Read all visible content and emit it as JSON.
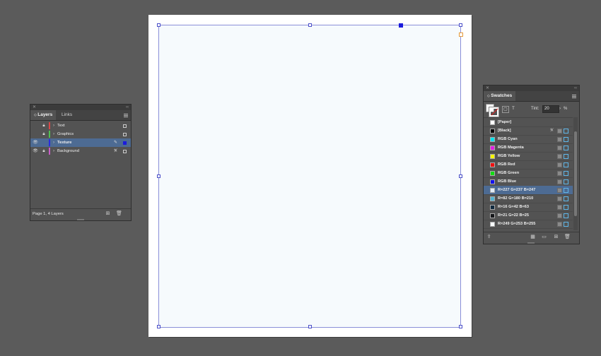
{
  "layers_panel": {
    "tabs": [
      {
        "label": "Layers"
      },
      {
        "label": "Links"
      }
    ],
    "layers": [
      {
        "name": "Text",
        "color": "#d94848",
        "visible": false,
        "locked": true,
        "selected": false
      },
      {
        "name": "Graphics",
        "color": "#52c152",
        "visible": false,
        "locked": true,
        "selected": false
      },
      {
        "name": "Texture",
        "color": "#2a2ae0",
        "visible": true,
        "locked": false,
        "selected": true
      },
      {
        "name": "Background",
        "color": "#c85dc8",
        "visible": true,
        "locked": true,
        "selected": false
      }
    ],
    "footer": {
      "status": "Page 1, 4 Layers"
    }
  },
  "swatches_panel": {
    "tab": {
      "label": "Swatches"
    },
    "tint": {
      "label": "Tint:",
      "value": "20",
      "unit": "%"
    },
    "swatches": [
      {
        "name": "[Paper]",
        "color": "#ffffff"
      },
      {
        "name": "[Black]",
        "color": "#000000"
      },
      {
        "name": "RGB Cyan",
        "color": "#00e5ee"
      },
      {
        "name": "RGB Magenta",
        "color": "#e020e0"
      },
      {
        "name": "RGB Yellow",
        "color": "#f5f500"
      },
      {
        "name": "RGB Red",
        "color": "#ee1111"
      },
      {
        "name": "RGB Green",
        "color": "#11dd11"
      },
      {
        "name": "RGB Blue",
        "color": "#1111ee"
      },
      {
        "name": "R=227 G=237 B=247",
        "color": "#e3edf7"
      },
      {
        "name": "R=82 G=180 B=210",
        "color": "#52b4d2"
      },
      {
        "name": "R=16 G=42 B=63",
        "color": "#102a3f"
      },
      {
        "name": "R=21 G=22 B=25",
        "color": "#151619"
      },
      {
        "name": "R=249 G=253 B=255",
        "color": "#f9fdff"
      }
    ]
  },
  "document": {
    "page_color": "#ffffff",
    "frame_fill": "#f6fafd",
    "frame_stroke": "#8a8fd8"
  }
}
